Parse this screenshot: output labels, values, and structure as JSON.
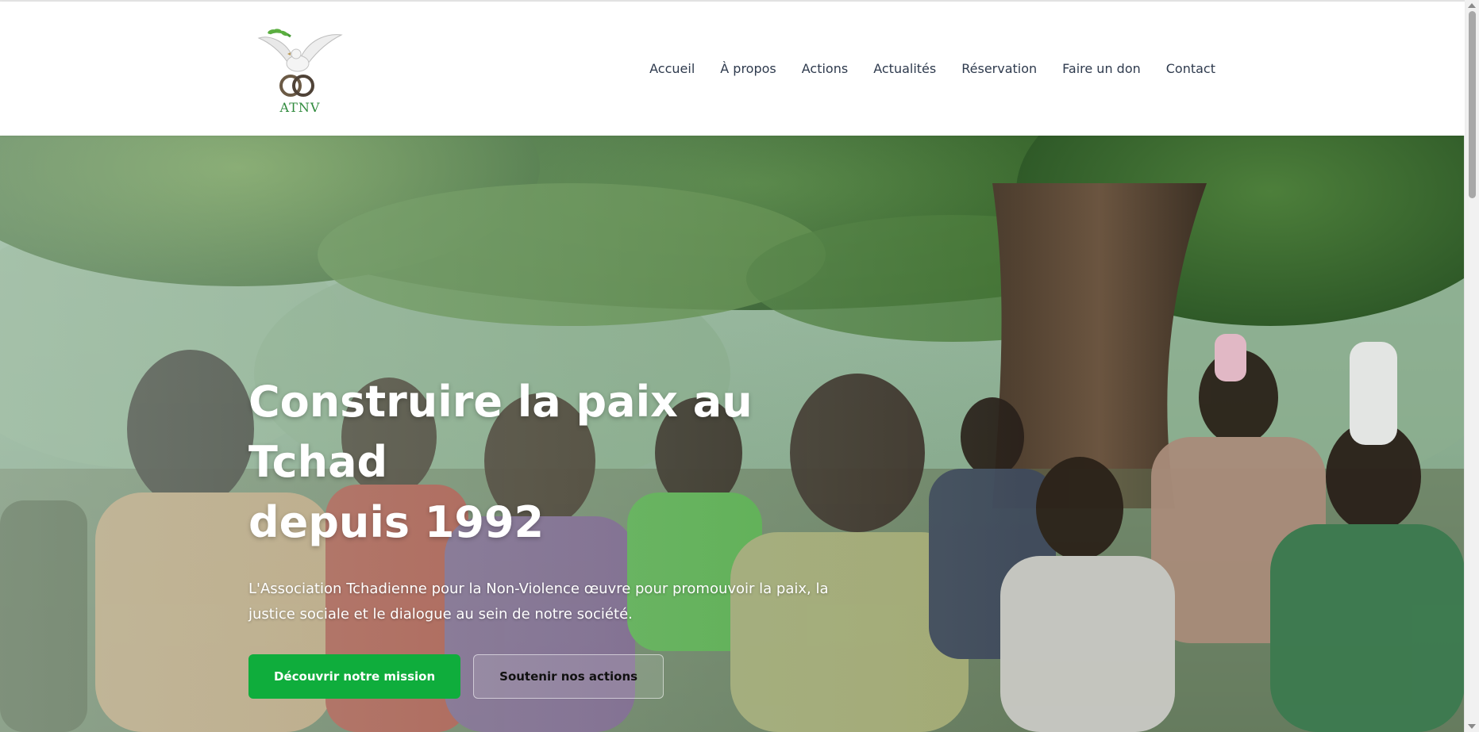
{
  "site": {
    "logo_text": "ATNV",
    "logo_icon": "dove-with-rings-icon"
  },
  "nav": {
    "items": [
      {
        "label": "Accueil"
      },
      {
        "label": "À propos"
      },
      {
        "label": "Actions"
      },
      {
        "label": "Actualités"
      },
      {
        "label": "Réservation"
      },
      {
        "label": "Faire un don"
      },
      {
        "label": "Contact"
      }
    ]
  },
  "hero": {
    "title_line1": "Construire la paix au Tchad",
    "title_line2": "depuis 1992",
    "description": "L'Association Tchadienne pour la Non-Violence œuvre pour promouvoir la paix, la justice sociale et le dialogue au sein de notre société.",
    "primary_button": "Découvrir notre mission",
    "secondary_button": "Soutenir nos actions",
    "background_image": "photo-community-gathering-under-tree"
  },
  "colors": {
    "accent": "#0fad3c",
    "nav_text": "#2e3a4d",
    "logo_green": "#2f8a3c"
  }
}
